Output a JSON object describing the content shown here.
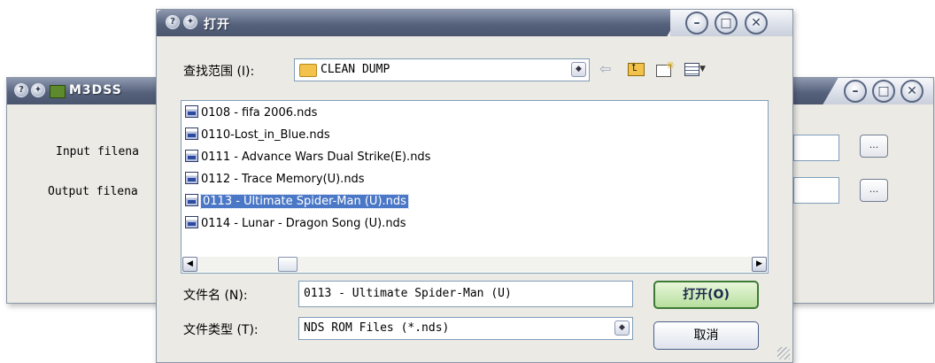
{
  "back_window": {
    "title": "M3DSS",
    "input_label": "Input filena",
    "output_label": "Output filena",
    "browse_label": "..."
  },
  "dialog": {
    "title": "打开",
    "look_in_label": "查找范围 (I):",
    "look_in_value": "CLEAN DUMP",
    "files": [
      "0108 - fifa 2006.nds",
      "0110-Lost_in_Blue.nds",
      "0111 - Advance Wars Dual Strike(E).nds",
      "0112 - Trace Memory(U).nds",
      "0113 - Ultimate Spider-Man (U).nds",
      "0114 - Lunar - Dragon Song (U).nds"
    ],
    "selected_index": 4,
    "filename_label": "文件名 (N):",
    "filename_value": "0113 - Ultimate Spider-Man (U)",
    "filetype_label": "文件类型 (T):",
    "filetype_value": "NDS ROM Files (*.nds)",
    "open_button": "打开(O)",
    "cancel_button": "取消"
  },
  "colors": {
    "titlebar_dark": "#56627c",
    "selection": "#4b78c6",
    "open_button_bg": "#c9e8b4",
    "folder": "#f3c24a"
  },
  "icons": [
    "help-icon",
    "pin-icon",
    "minimize-icon",
    "maximize-icon",
    "close-icon",
    "folder-icon",
    "back-arrow-icon",
    "up-folder-icon",
    "new-folder-icon",
    "view-menu-icon",
    "nds-file-icon"
  ]
}
